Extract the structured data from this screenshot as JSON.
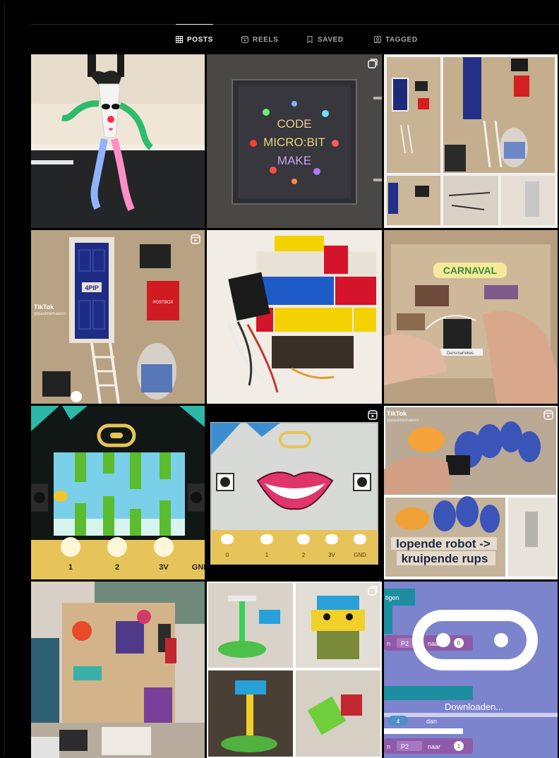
{
  "tabs": [
    {
      "label": "POSTS",
      "icon": "grid-icon",
      "active": true
    },
    {
      "label": "REELS",
      "icon": "reels-icon",
      "active": false
    },
    {
      "label": "SAVED",
      "icon": "bookmark-icon",
      "active": false
    },
    {
      "label": "TAGGED",
      "icon": "tagged-icon",
      "active": false
    }
  ],
  "posts": {
    "p2": {
      "sign_lines": [
        "CODE",
        "MICRO:BIT",
        "MAKE"
      ]
    },
    "p4": {
      "tiktok": "TikTok",
      "handle": "@paulinemaasnl",
      "door_number": "4PIP",
      "mailbox": "POSTBOX"
    },
    "p6": {
      "banner": "CARNAVAL",
      "sign": "Dansmariekes"
    },
    "p7": {
      "pins": [
        "1",
        "2",
        "3V",
        "GND"
      ]
    },
    "p8": {
      "pins": [
        "0",
        "1",
        "2",
        "3V",
        "GND"
      ]
    },
    "p9": {
      "tiktok": "TikTok",
      "handle": "@paulinemaasnl",
      "caption_line1": "lopende robot ->",
      "caption_line2": "kruipende rups"
    },
    "p12": {
      "top_label": "tigen",
      "pin_row1_left": "n",
      "pin_row1_pin": "P2",
      "pin_row1_to": "naar",
      "pin_row1_val": "0",
      "download": "Downloaden...",
      "count": "4",
      "count_unit": "dan",
      "pin_row2_left": "n",
      "pin_row2_pin": "P2",
      "pin_row2_to": "naar",
      "pin_row2_val": "1"
    }
  },
  "colors": {
    "accent_active": "#f5f5f5",
    "tab_inactive": "#a8a8a8",
    "scratch_purple": "#8f5ba9",
    "pin_gold": "#e7c45a"
  }
}
